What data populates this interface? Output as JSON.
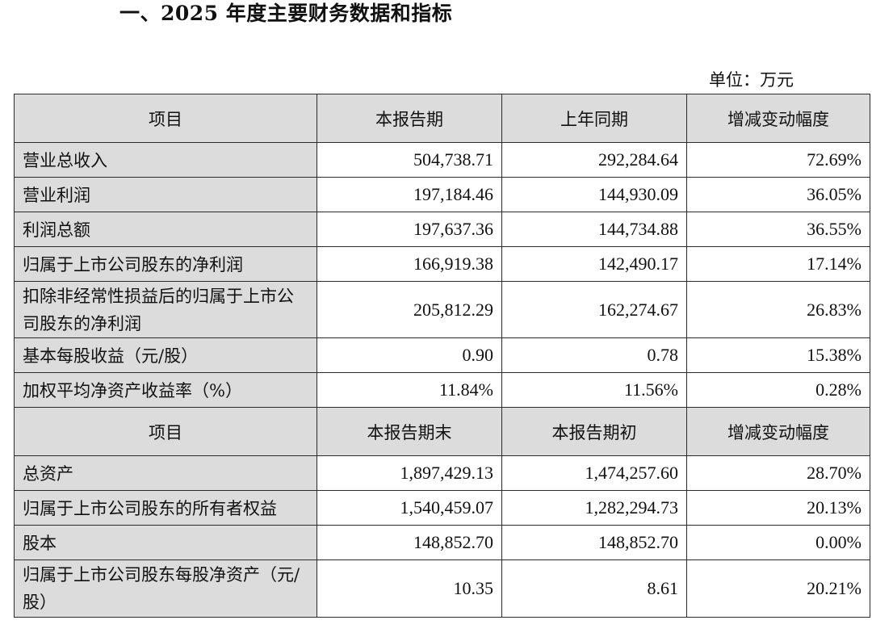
{
  "title": "一、2025 年度主要财务数据和指标",
  "unit": "单位：万元",
  "section1": {
    "header": [
      "项目",
      "本报告期",
      "上年同期",
      "增减变动幅度"
    ],
    "rows": [
      {
        "label": "营业总收入",
        "current": "504,738.71",
        "previous": "292,284.64",
        "change": "72.69%"
      },
      {
        "label": "营业利润",
        "current": "197,184.46",
        "previous": "144,930.09",
        "change": "36.05%"
      },
      {
        "label": "利润总额",
        "current": "197,637.36",
        "previous": "144,734.88",
        "change": "36.55%"
      },
      {
        "label": "归属于上市公司股东的净利润",
        "current": "166,919.38",
        "previous": "142,490.17",
        "change": "17.14%"
      },
      {
        "label": "扣除非经常性损益后的归属于上市公司股东的净利润",
        "current": "205,812.29",
        "previous": "162,274.67",
        "change": "26.83%"
      },
      {
        "label": "基本每股收益（元/股）",
        "current": "0.90",
        "previous": "0.78",
        "change": "15.38%"
      },
      {
        "label": "加权平均净资产收益率（%）",
        "current": "11.84%",
        "previous": "11.56%",
        "change": "0.28%"
      }
    ]
  },
  "section2": {
    "header": [
      "项目",
      "本报告期末",
      "本报告期初",
      "增减变动幅度"
    ],
    "rows": [
      {
        "label": "总资产",
        "current": "1,897,429.13",
        "previous": "1,474,257.60",
        "change": "28.70%"
      },
      {
        "label": "归属于上市公司股东的所有者权益",
        "current": "1,540,459.07",
        "previous": "1,282,294.73",
        "change": "20.13%"
      },
      {
        "label": "股本",
        "current": "148,852.70",
        "previous": "148,852.70",
        "change": "0.00%"
      },
      {
        "label": "归属于上市公司股东每股净资产（元/股）",
        "current": "10.35",
        "previous": "8.61",
        "change": "20.21%"
      }
    ]
  }
}
